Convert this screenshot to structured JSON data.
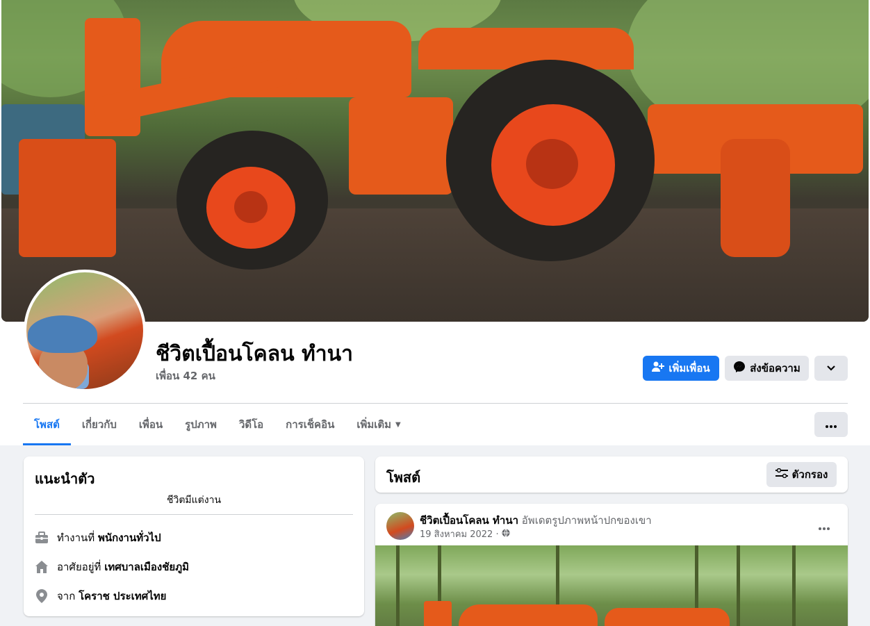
{
  "profile": {
    "name": "ชีวิตเปื้อนโคลน ทำนา",
    "friends": "เพื่อน 42 คน"
  },
  "actions": {
    "add_friend": "เพิ่มเพื่อน",
    "message": "ส่งข้อความ"
  },
  "tabs": [
    {
      "label": "โพสต์",
      "active": true
    },
    {
      "label": "เกี่ยวกับ"
    },
    {
      "label": "เพื่อน"
    },
    {
      "label": "รูปภาพ"
    },
    {
      "label": "วิดีโอ"
    },
    {
      "label": "การเช็คอิน"
    },
    {
      "label": "เพิ่มเติม"
    }
  ],
  "intro": {
    "title": "แนะนำตัว",
    "bio": "ชีวิตมีแต่งาน",
    "work_prefix": "ทำงานที่",
    "work_value": "พนักงานทั่วไป",
    "lives_prefix": "อาศัยอยู่ที่",
    "lives_value": "เทศบาลเมืองชัยภูมิ",
    "from_prefix": "จาก",
    "from_value": "โคราช ประเทศไทย"
  },
  "posts": {
    "title": "โพสต์",
    "filter": "ตัวกรอง",
    "item": {
      "author": "ชีวิตเปื้อนโคลน ทำนา",
      "action": "อัพเดตรูปภาพหน้าปกของเขา",
      "date": "19 สิงหาคม 2022 ·"
    }
  },
  "colors": {
    "accent": "#1877f2",
    "background": "#f0f2f5",
    "secondary_button": "#e4e6eb",
    "muted_text": "#65676b"
  }
}
